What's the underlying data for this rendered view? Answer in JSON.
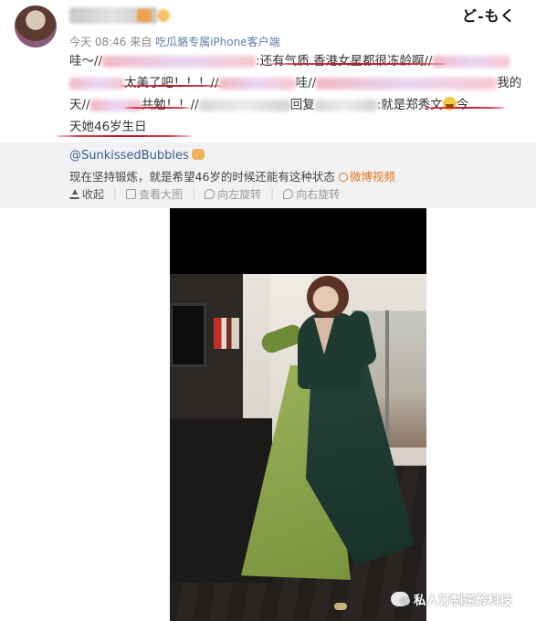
{
  "post": {
    "meta_time": "今天 08:46",
    "meta_from": "来自",
    "meta_source": "吃瓜貉专属iPhone客户端",
    "line1": {
      "start": "哇～//",
      "sep1": ":",
      "phrase_a": "还有气质",
      "phrase_b": "香港女星都很冻龄啊",
      "end": "//"
    },
    "line2": {
      "phrase": "太美了吧！！！",
      "sep": "//",
      "mid": "哇//",
      "end": "我的"
    },
    "line3": {
      "start": "天//",
      "phrase": "共勉！！",
      "sep": "//",
      "mid": "回复",
      "sep2": ":",
      "phrase_b": "就是郑秀文",
      "end": "今"
    },
    "line4": "天她46岁生日",
    "emoji_name": "laughing-face"
  },
  "repost": {
    "author": "@SunkissedBubbles",
    "text": "现在坚持锻炼，就是希望46岁的时候还能有这种状态",
    "video_label": "微博视频",
    "toolbar": [
      "收起",
      "查看大图",
      "向左旋转",
      "向右旋转"
    ]
  },
  "video": {
    "description_visible": false
  },
  "watermark": {
    "text": "私人订制逆龄科技"
  },
  "corner_logo": "ど-もく",
  "colors": {
    "underline": "#c3182c",
    "link": "#36618f",
    "video_link": "#e3741a",
    "repost_bg": "#f2f2f5"
  }
}
